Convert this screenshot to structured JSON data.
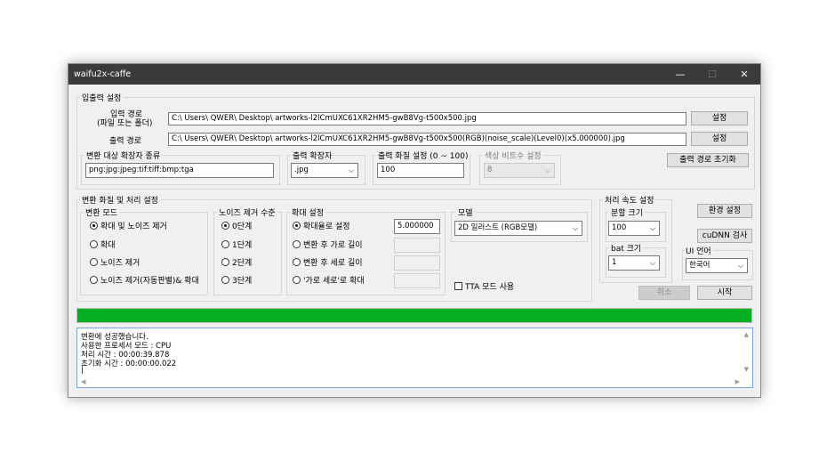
{
  "window": {
    "title": "waifu2x-caffe",
    "minimize": "—",
    "maximize": "☐",
    "close": "✕"
  },
  "io": {
    "group_label": "입출력 설정",
    "input_label_1": "입력 경로",
    "input_label_2": "(파일 또는 폴더)",
    "input_path": "C:\\  Users\\  QWER\\  Desktop\\  artworks-l2lCmUXC61XR2HM5-gwB8Vg-t500x500.jpg",
    "output_label": "출력 경로",
    "output_path": "C:\\  Users\\  QWER\\  Desktop\\  artworks-l2lCmUXC61XR2HM5-gwB8Vg-t500x500(RGB)(noise_scale)(Level0)(x5.000000).jpg",
    "set_button_1": "설정",
    "set_button_2": "설정",
    "ext_group_label": "변환 대상 확장자 종류",
    "ext_value": "png:jpg:jpeg:tif:tiff:bmp:tga",
    "out_ext_group_label": "출력 확장자",
    "out_ext_value": ".jpg",
    "quality_group_label": "출력 화질 설정 (0 ~ 100)",
    "quality_value": "100",
    "bitdepth_group_label": "색상 비트수 설정",
    "bitdepth_value": "8",
    "reset_output_button": "출력 경로 초기화"
  },
  "convert": {
    "group_label": "변환 화질 및 처리 설정",
    "mode_group_label": "변환 모드",
    "modes": [
      "확대 및 노이즈 제거",
      "확대",
      "노이즈 제거",
      "노이즈 제거(자동판별)& 확대"
    ],
    "mode_selected_index": 0,
    "noise_group_label": "노이즈 제거 수준",
    "noise_levels": [
      "0단계",
      "1단계",
      "2단계",
      "3단계"
    ],
    "noise_selected_index": 0,
    "scale_group_label": "확대 설정",
    "scale_options": [
      "확대율로 설정",
      "변환 후 가로 길이",
      "변환 후 세로 길이",
      "'가로 세로'로 확대"
    ],
    "scale_selected_index": 0,
    "scale_value": "5.000000",
    "model_group_label": "모델",
    "model_value": "2D 일러스트 (RGB모델)",
    "tta_label": "TTA 모드 사용"
  },
  "speed": {
    "group_label": "처리 속도 설정",
    "split_group_label": "분할 크기",
    "split_value": "100",
    "batch_group_label": "bat 크기",
    "batch_value": "1",
    "env_button": "환경 설정",
    "cudnn_button": "cuDNN 검사",
    "ui_lang_group_label": "UI 언어",
    "ui_lang_value": "한국어"
  },
  "actions": {
    "cancel": "취소",
    "start": "시작"
  },
  "progress": {
    "fraction": 1.0
  },
  "log": {
    "lines": [
      "변환에 성공했습니다.",
      "사용한 프로세서 모드 : CPU",
      "처리 시간 : 00:00:39.878",
      "초기화 시간 : 00:00:00.022"
    ]
  }
}
